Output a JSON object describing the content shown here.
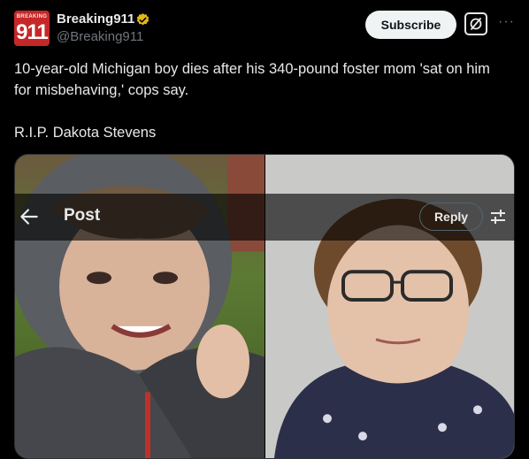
{
  "header": {
    "avatar_top": "BREAKING",
    "avatar_number": "911",
    "display_name": "Breaking911",
    "handle": "@Breaking911",
    "subscribe_label": "Subscribe",
    "more_label": "···"
  },
  "tweet": {
    "text": "10-year-old Michigan boy dies after his 340-pound foster mom 'sat on him for misbehaving,' cops say.\n\nR.I.P. Dakota Stevens"
  },
  "overlay": {
    "title": "Post",
    "reply_label": "Reply"
  },
  "colors": {
    "background": "#000000",
    "text": "#e7e9ea",
    "muted": "#71767b",
    "verified_badge": "#e2b719",
    "avatar_red": "#c62828"
  },
  "icons": {
    "verified": "verified-badge-icon",
    "grok": "grok-icon",
    "more": "more-icon",
    "back": "back-arrow-icon",
    "filter": "sliders-icon"
  }
}
